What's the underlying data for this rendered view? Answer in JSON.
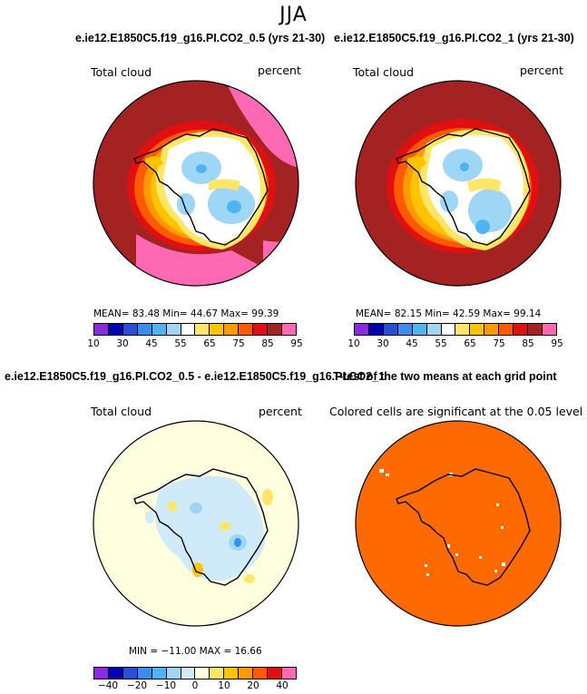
{
  "figure": {
    "season": "JJA"
  },
  "panels": {
    "tl": {
      "title": "e.ie12.E1850C5.f19_g16.PI.CO2_0.5 (yrs 21-30)",
      "left_label": "Total cloud",
      "right_label": "percent",
      "stats": "MEAN=   83.48   Min=   44.67   Max=   99.39"
    },
    "tr": {
      "title": "e.ie12.E1850C5.f19_g16.PI.CO2_1 (yrs 21-30)",
      "left_label": "Total cloud",
      "right_label": "percent",
      "stats": "MEAN=   82.15   Min=   42.59   Max=   99.14"
    },
    "bl": {
      "title": "e.ie12.E1850C5.f19_g16.PI.CO2_0.5 - e.ie12.E1850C5.f19_g16.PI.CO2_1",
      "left_label": "Total cloud",
      "right_label": "percent",
      "stats": "MIN = −11.00  MAX =   16.66"
    },
    "br": {
      "title": "T-test of the two means at each grid point",
      "left_label": "Colored cells are significant at the 0.05 level"
    }
  },
  "colorbars": {
    "abs": {
      "colors": [
        "#8a2be2",
        "#0000b4",
        "#2a4fd7",
        "#3c8cf0",
        "#50b4f0",
        "#9ed6f5",
        "#ffffff",
        "#ffe666",
        "#ffc300",
        "#ff9a00",
        "#ff5a00",
        "#e01010",
        "#a52222",
        "#ff69b4"
      ],
      "ticks": [
        "10",
        "30",
        "45",
        "55",
        "65",
        "75",
        "85",
        "95"
      ]
    },
    "diff": {
      "colors": [
        "#8a2be2",
        "#0000b4",
        "#2a4fd7",
        "#3c8cf0",
        "#50b4f0",
        "#9ed6f5",
        "#cfeaf8",
        "#ffffe0",
        "#ffe666",
        "#ffc300",
        "#ff9a00",
        "#ff5a00",
        "#e01010",
        "#ff69b4"
      ],
      "ticks": [
        "−40",
        "−20",
        "−10",
        "0",
        "10",
        "20",
        "40"
      ]
    }
  },
  "chart_data": [
    {
      "type": "heatmap",
      "title": "e.ie12.E1850C5.f19_g16.PI.CO2_0.5 (yrs 21-30)",
      "variable": "Total cloud",
      "units": "percent",
      "projection": "south-polar stereographic",
      "mean": 83.48,
      "min": 44.67,
      "max": 99.39,
      "colorbar_ticks": [
        10,
        30,
        45,
        55,
        65,
        75,
        85,
        95
      ]
    },
    {
      "type": "heatmap",
      "title": "e.ie12.E1850C5.f19_g16.PI.CO2_1 (yrs 21-30)",
      "variable": "Total cloud",
      "units": "percent",
      "projection": "south-polar stereographic",
      "mean": 82.15,
      "min": 42.59,
      "max": 99.14,
      "colorbar_ticks": [
        10,
        30,
        45,
        55,
        65,
        75,
        85,
        95
      ]
    },
    {
      "type": "heatmap",
      "title": "e.ie12.E1850C5.f19_g16.PI.CO2_0.5 - e.ie12.E1850C5.f19_g16.PI.CO2_1",
      "variable": "Total cloud",
      "units": "percent",
      "projection": "south-polar stereographic",
      "min": -11.0,
      "max": 16.66,
      "colorbar_ticks": [
        -40,
        -20,
        -10,
        0,
        10,
        20,
        40
      ]
    },
    {
      "type": "heatmap",
      "title": "T-test of the two means at each grid point",
      "annotation": "Colored cells are significant at the 0.05 level",
      "projection": "south-polar stereographic",
      "significance_level": 0.05
    }
  ]
}
